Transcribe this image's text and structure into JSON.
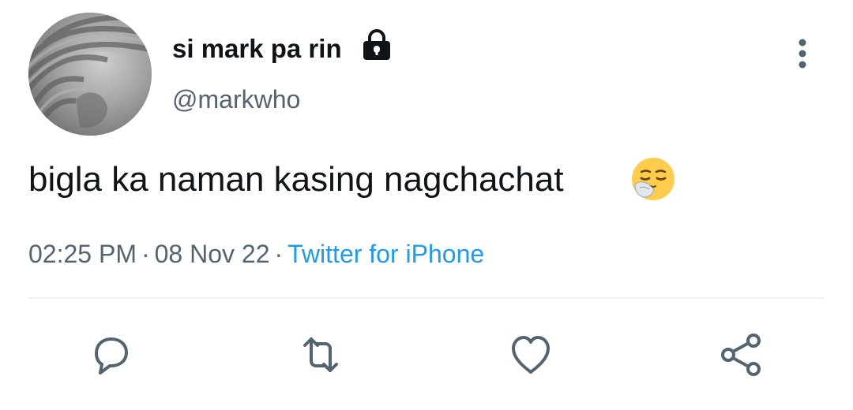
{
  "user": {
    "display_name": "si mark pa rin",
    "handle": "@markwho",
    "protected_icon": "lock-icon"
  },
  "tweet": {
    "text": "bigla ka naman kasing nagchachat",
    "emoji": "relieved-face-with-mask"
  },
  "meta": {
    "time": "02:25 PM",
    "separator": "·",
    "date": "08 Nov 22",
    "source": "Twitter for iPhone"
  },
  "actions": [
    "reply-icon",
    "retweet-icon",
    "like-icon",
    "share-icon"
  ],
  "colors": {
    "text": "#0f1419",
    "secondary": "#536471",
    "link": "#1d9bf0",
    "divider": "#eff3f4"
  }
}
